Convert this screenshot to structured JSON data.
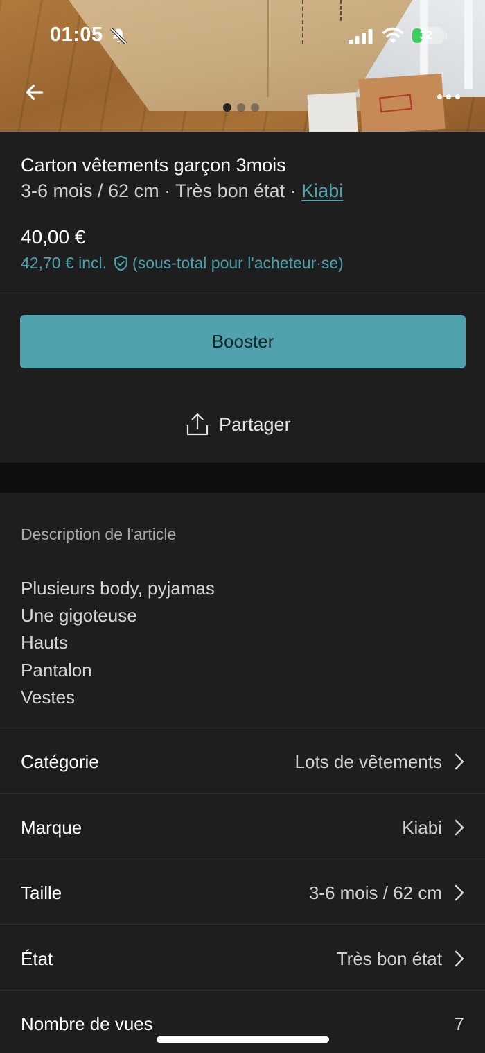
{
  "status_bar": {
    "time": "01:05",
    "battery": "32"
  },
  "gallery": {
    "page_count": 3,
    "active_page": 1
  },
  "product": {
    "title": "Carton vêtements garçon 3mois",
    "size": "3-6 mois / 62 cm",
    "condition": "Très bon état",
    "separator": " · ",
    "brand": "Kiabi",
    "price": "40,00 €",
    "price_incl": "42,70 € incl.",
    "price_incl_note": "(sous-total pour l'acheteur·se)"
  },
  "actions": {
    "booster_label": "Booster",
    "share_label": "Partager"
  },
  "description": {
    "heading": "Description de l'article",
    "lines": [
      "Plusieurs body, pyjamas",
      "Une gigoteuse",
      "Hauts",
      "Pantalon",
      "Vestes"
    ]
  },
  "details": [
    {
      "label": "Catégorie",
      "value": "Lots de vêtements",
      "chevron": true
    },
    {
      "label": "Marque",
      "value": "Kiabi",
      "chevron": true
    },
    {
      "label": "Taille",
      "value": "3-6 mois / 62 cm",
      "chevron": true
    },
    {
      "label": "État",
      "value": "Très bon état",
      "chevron": true
    },
    {
      "label": "Nombre de vues",
      "value": "7",
      "chevron": false
    }
  ],
  "colors": {
    "background": "#1e1e1f",
    "accent": "#4fa2ad",
    "link": "#52a3ad"
  },
  "icons": {
    "back": "arrow-left-icon",
    "more": "more-horizontal-icon",
    "share": "share-icon",
    "shield": "shield-check-icon",
    "chevron": "chevron-right-icon",
    "bell_off": "bell-off-icon"
  }
}
